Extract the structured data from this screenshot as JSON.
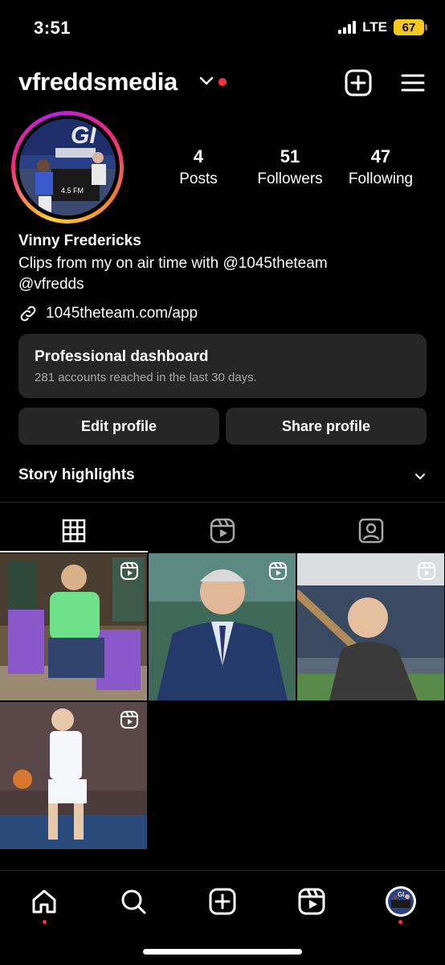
{
  "status": {
    "time": "3:51",
    "network": "LTE",
    "battery": "67"
  },
  "header": {
    "username": "vfreddsmedia",
    "icons": [
      "chevron-down-icon",
      "notification-dot",
      "create-post-icon",
      "menu-icon"
    ]
  },
  "profile": {
    "stats": [
      {
        "value": "4",
        "label": "Posts"
      },
      {
        "value": "51",
        "label": "Followers"
      },
      {
        "value": "47",
        "label": "Following"
      }
    ],
    "full_name": "Vinny Fredericks",
    "bio_line1": "Clips from my on air time with @1045theteam",
    "bio_line2": "@vfredds",
    "link": "1045theteam.com/app",
    "has_story_ring": true
  },
  "dashboard": {
    "title": "Professional dashboard",
    "subtitle": "281 accounts reached in the last 30 days."
  },
  "actions": {
    "edit_label": "Edit profile",
    "share_label": "Share profile"
  },
  "highlights": {
    "label": "Story highlights"
  },
  "tabs": [
    {
      "name": "grid",
      "icon": "grid-icon",
      "active": true
    },
    {
      "name": "reels",
      "icon": "reels-icon",
      "active": false
    },
    {
      "name": "tagged",
      "icon": "tagged-icon",
      "active": false
    }
  ],
  "posts": [
    {
      "type": "reel",
      "subject": "man in green shirt on purple chair"
    },
    {
      "type": "reel",
      "subject": "announcer in suit"
    },
    {
      "type": "reel",
      "subject": "man with baseball bat at stadium"
    },
    {
      "type": "reel",
      "subject": "basketball player dribbling"
    }
  ],
  "bottom_nav": [
    {
      "icon": "home-icon",
      "active": true,
      "dot": true
    },
    {
      "icon": "search-icon",
      "active": false,
      "dot": false
    },
    {
      "icon": "create-icon",
      "active": false,
      "dot": false
    },
    {
      "icon": "reels-icon",
      "active": false,
      "dot": false
    },
    {
      "icon": "profile-avatar-icon",
      "active": false,
      "dot": true
    }
  ],
  "colors": {
    "background": "#000000",
    "surface": "#262626",
    "muted_text": "#a8a8a8",
    "notification": "#ff3040",
    "battery": "#f4c91f"
  }
}
